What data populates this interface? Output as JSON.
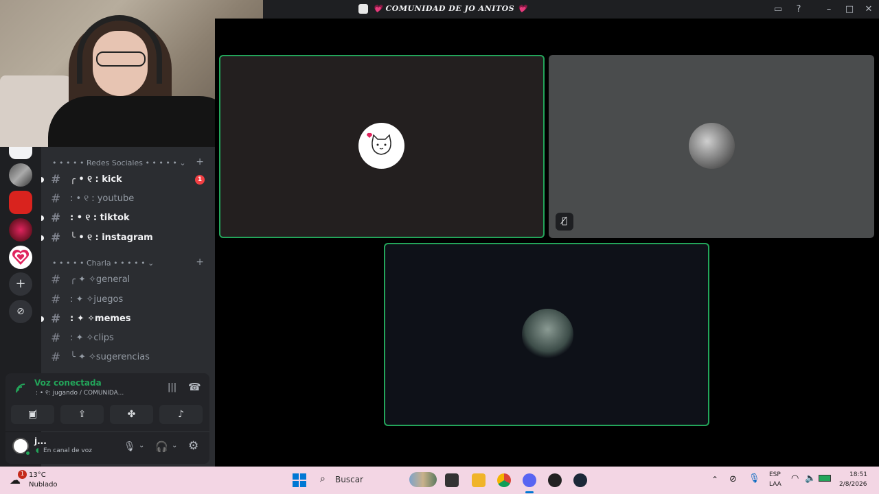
{
  "window": {
    "title": "COMUNIDAD DE JO ANITOS"
  },
  "categories": [
    {
      "label": "Redes Sociales"
    },
    {
      "label": "Charla"
    }
  ],
  "channels": [
    {
      "label": "╭ • ୧ : kick",
      "emoji": "💚",
      "unread": true,
      "badge": "1"
    },
    {
      "label": ": • ୧ : youtube",
      "unread": false
    },
    {
      "label": ": • ୧ : tiktok",
      "unread": true
    },
    {
      "label": "╰ • ୧ : instagram",
      "unread": true
    },
    {
      "label": "╭ ✦ ✧general",
      "emoji": "💗",
      "unread": false
    },
    {
      "label": ": ✦ ✧juegos",
      "unread": false
    },
    {
      "label": ": ✦ ✧memes",
      "unread": true
    },
    {
      "label": ": ✦ ✧clips",
      "unread": false
    },
    {
      "label": "╰ ✦ ✧sugerencias",
      "unread": false
    }
  ],
  "voice": {
    "title": "Voz conectada",
    "subtitle": ": • ୧: jugando / COMUNIDA..."
  },
  "user": {
    "name": "j...",
    "status": "En canal de voz"
  },
  "taskbar": {
    "weather_temp": "13°C",
    "weather_desc": "Nublado",
    "weather_badge": "1",
    "search_placeholder": "Buscar",
    "lang_1": "ESP",
    "lang_2": "LAA",
    "time": "18:51",
    "date": "2/8/2026"
  },
  "colors": {
    "speaking_border": "#23a55a",
    "taskbar_bg": "#f3d6e4",
    "sidebar_bg": "#2b2d31"
  }
}
